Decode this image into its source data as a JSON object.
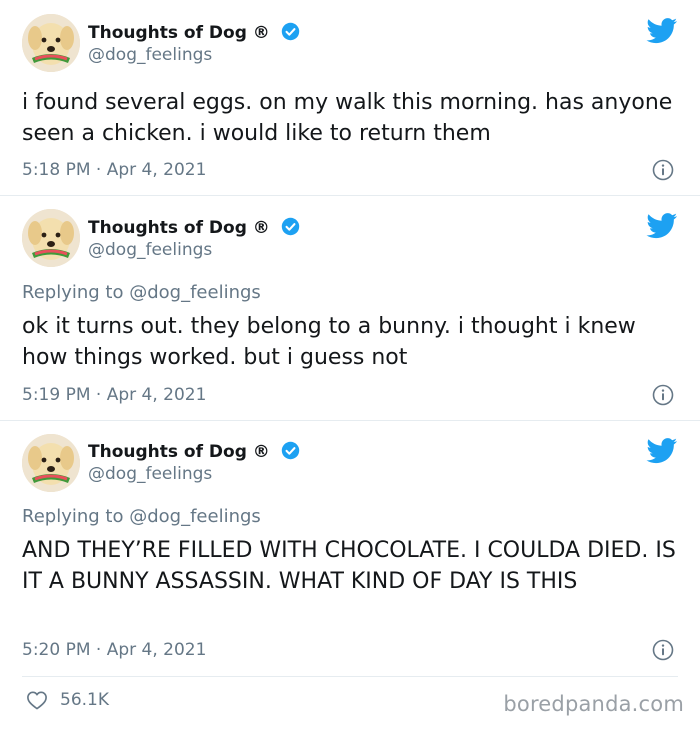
{
  "tweets": [
    {
      "author_name": "Thoughts of Dog",
      "registered": "®",
      "handle": "@dog_feelings",
      "reply_prefix": "",
      "reply_handle": "",
      "text": "i found several eggs. on my walk this morning. has anyone seen a chicken. i would like to return them",
      "timestamp": "5:18 PM · Apr 4, 2021"
    },
    {
      "author_name": "Thoughts of Dog",
      "registered": "®",
      "handle": "@dog_feelings",
      "reply_prefix": "Replying to",
      "reply_handle": "@dog_feelings",
      "text": "ok it turns out. they belong to a bunny. i thought i knew how things worked. but i guess not",
      "timestamp": "5:19 PM · Apr 4, 2021"
    },
    {
      "author_name": "Thoughts of Dog",
      "registered": "®",
      "handle": "@dog_feelings",
      "reply_prefix": "Replying to",
      "reply_handle": "@dog_feelings",
      "text": "AND THEY’RE FILLED WITH CHOCOLATE. I COULDA DIED. IS IT A BUNNY ASSASSIN. WHAT KIND OF DAY IS THIS",
      "timestamp": "5:20 PM · Apr 4, 2021"
    }
  ],
  "footer": {
    "likes": "56.1K",
    "brand": "boredpanda.com"
  },
  "colors": {
    "twitter_blue": "#1da1f2",
    "muted_text": "#657786",
    "divider": "#e6ecf0"
  },
  "icons": [
    "verified-badge-icon",
    "twitter-bird-icon",
    "info-icon",
    "heart-icon"
  ]
}
